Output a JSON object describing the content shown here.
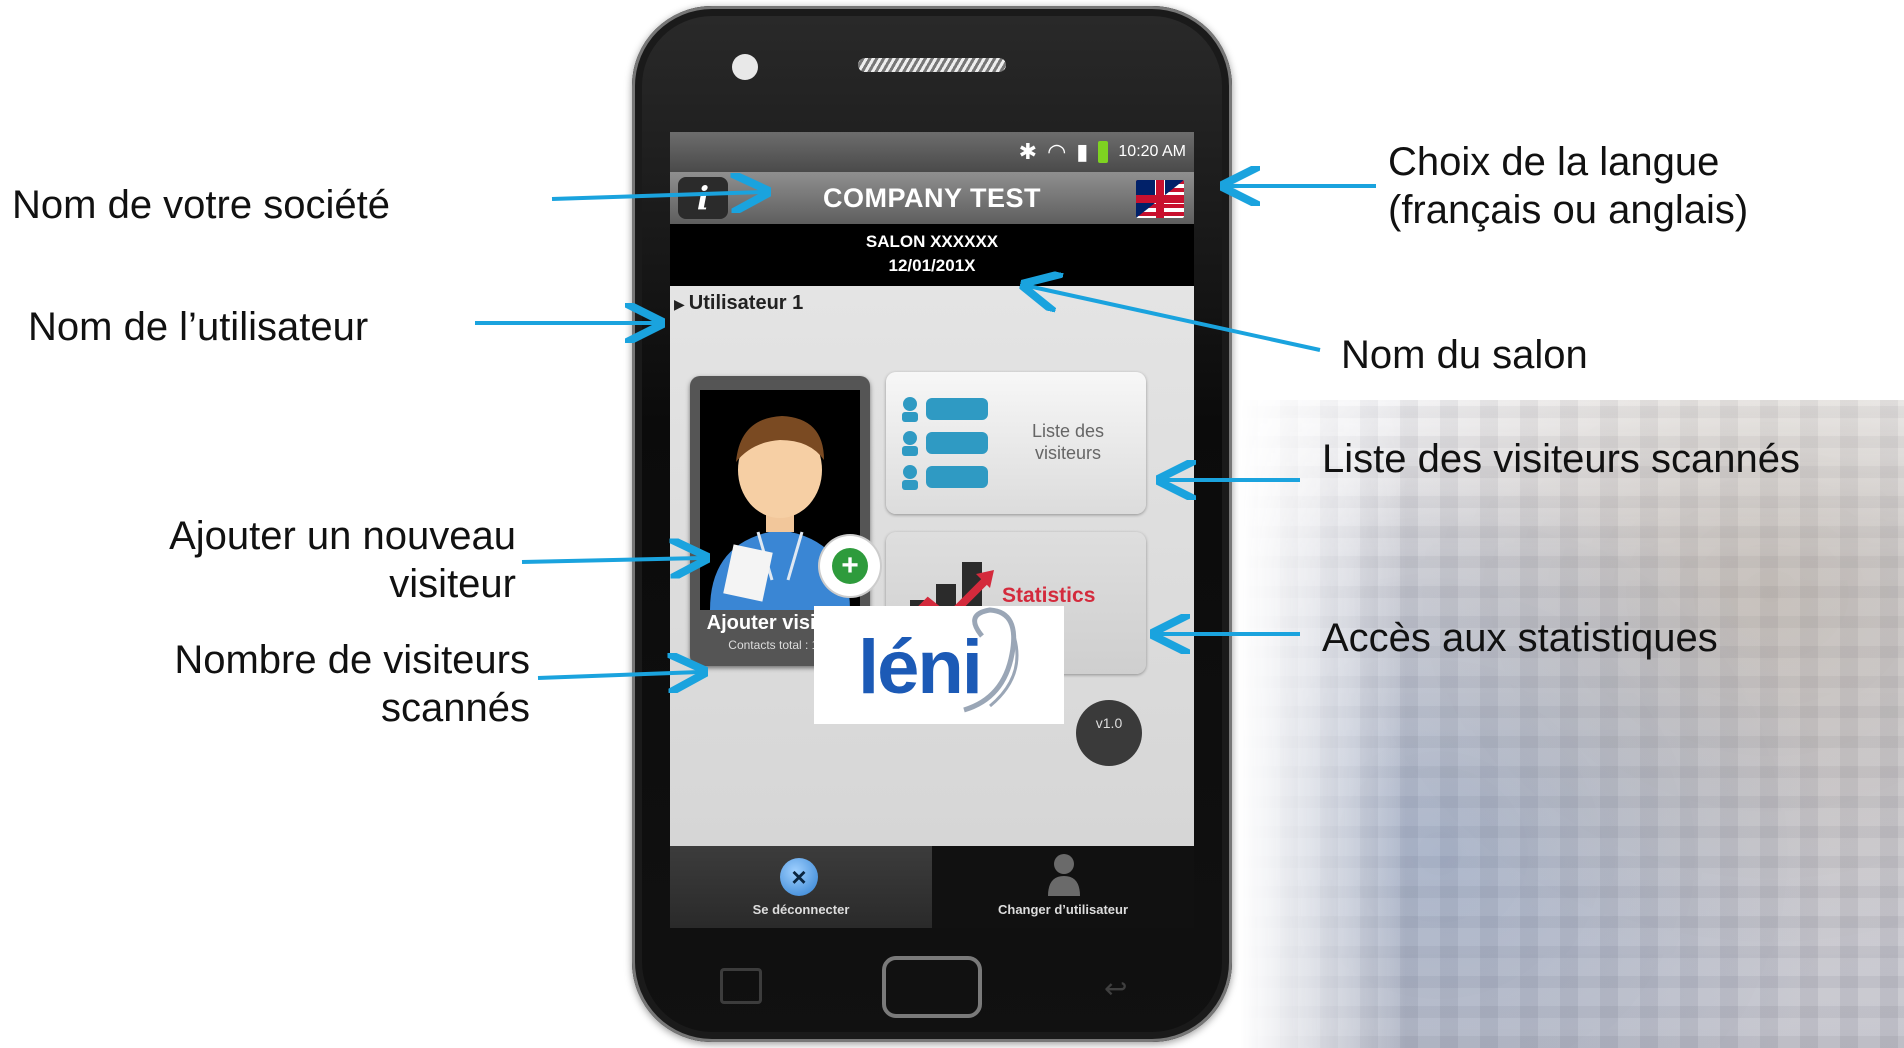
{
  "callouts": {
    "company_name": "Nom de votre société",
    "user_name": "Nom de l’utilisateur",
    "add_visitor_line1": "Ajouter un nouveau",
    "add_visitor_line2": "visiteur",
    "visitor_count_line1": "Nombre de visiteurs",
    "visitor_count_line2": "scannés",
    "language_line1": "Choix de la langue",
    "language_line2": "(français ou anglais)",
    "salon_name": "Nom du salon",
    "visitor_list": "Liste des visiteurs scannés",
    "statistics_access": "Accès aux statistiques"
  },
  "status_bar": {
    "time": "10:20 AM",
    "icons": [
      "bluetooth-icon",
      "wifi-icon",
      "signal-icon",
      "battery-icon"
    ]
  },
  "header": {
    "info_label": "i",
    "company": "COMPANY TEST",
    "language_flag": "uk-flag-icon"
  },
  "salon": {
    "name": "SALON XXXXXX",
    "date": "12/01/201X"
  },
  "user": {
    "label": "Utilisateur 1"
  },
  "add_card": {
    "label": "Ajouter visiteur",
    "count_text": "Contacts total  : 126"
  },
  "list_tile": {
    "line1": "Liste des",
    "line2": "visiteurs"
  },
  "stats_tile": {
    "label": "Statistics"
  },
  "logo": {
    "text": "léni"
  },
  "version": "v1.0",
  "bottom_bar": {
    "logout": "Se déconnecter",
    "switch_user": "Changer d’utilisateur"
  },
  "colors": {
    "arrow": "#1aa3de",
    "logo_blue": "#1c5ab6",
    "stats_red": "#d42a3c",
    "add_green": "#2e9b3c",
    "list_teal": "#2f9ac3"
  }
}
